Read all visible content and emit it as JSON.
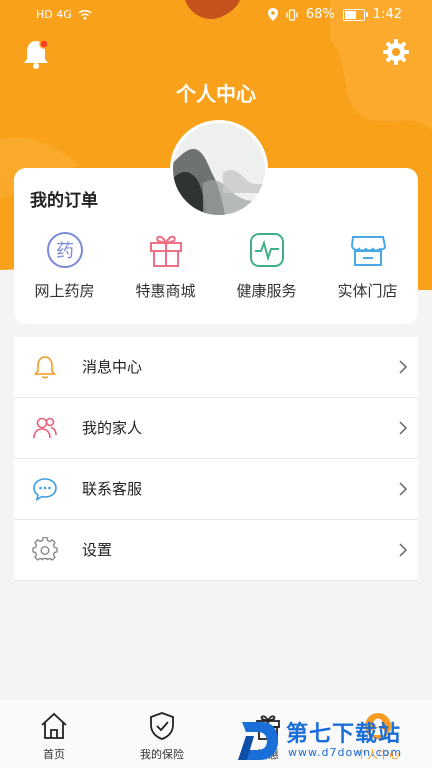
{
  "status_bar": {
    "left_text": "HD 4G",
    "battery_text": "68%",
    "battery_level": 0.68,
    "time": "1:42"
  },
  "header": {
    "title": "个人中心"
  },
  "order_card": {
    "title": "我的订单",
    "items": [
      {
        "label": "网上药房",
        "icon": "pharmacy-icon",
        "glyph": "药"
      },
      {
        "label": "特惠商城",
        "icon": "gift-icon"
      },
      {
        "label": "健康服务",
        "icon": "health-monitor-icon"
      },
      {
        "label": "实体门店",
        "icon": "store-icon"
      }
    ]
  },
  "menu": [
    {
      "label": "消息中心",
      "icon": "bell-icon"
    },
    {
      "label": "我的家人",
      "icon": "family-icon"
    },
    {
      "label": "联系客服",
      "icon": "chat-bubble-icon"
    },
    {
      "label": "设置",
      "icon": "settings-gear-icon"
    }
  ],
  "tabbar": [
    {
      "label": "首页",
      "icon": "home-icon"
    },
    {
      "label": "我的保险",
      "icon": "shield-check-icon"
    },
    {
      "label": "特惠",
      "icon": "gift-icon"
    },
    {
      "label": "个人中心",
      "icon": "person-icon",
      "active": true
    }
  ],
  "watermark": {
    "brand": "第七下载站",
    "url": "www.d7down.com"
  },
  "colors": {
    "header_orange": "#f9a11b",
    "accent_orange": "#f59a23",
    "page_bg": "#f4f4f4"
  }
}
